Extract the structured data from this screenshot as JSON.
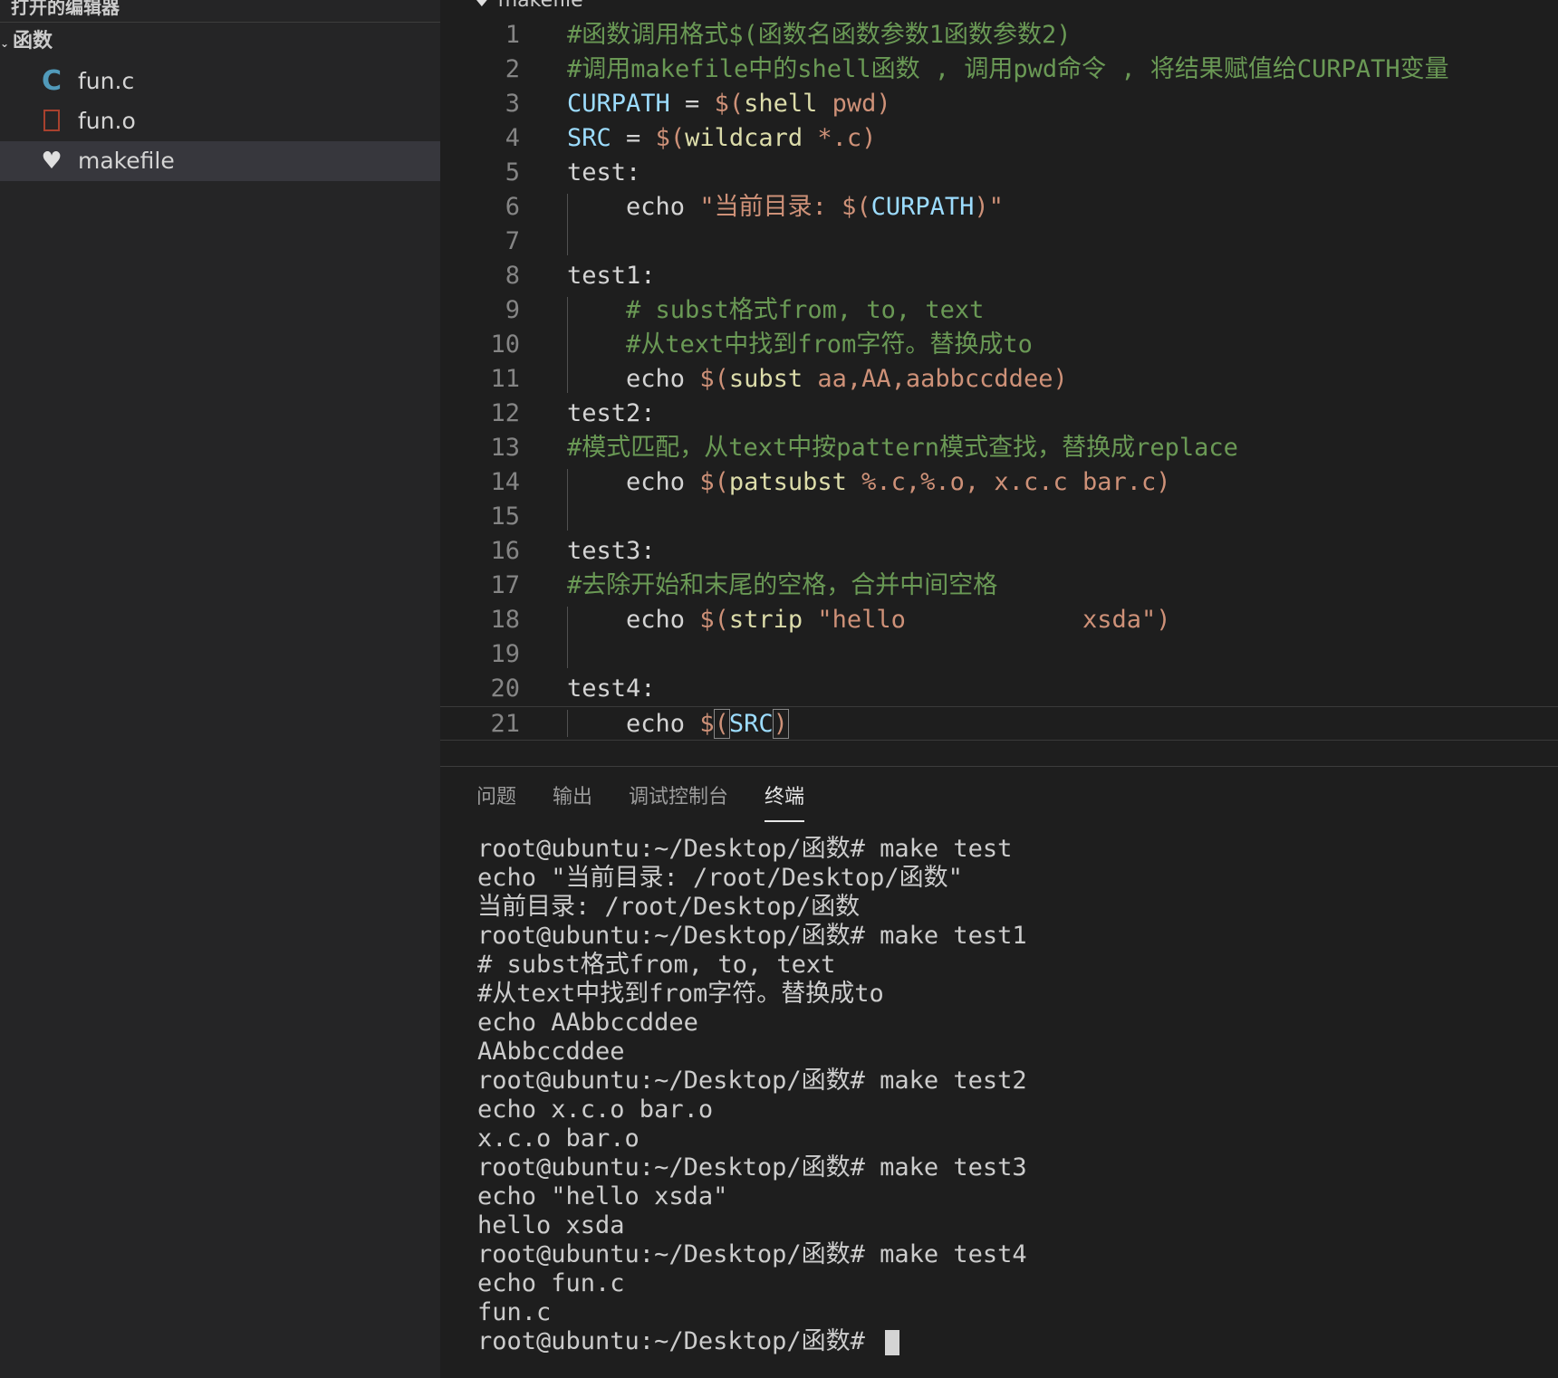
{
  "sidebar": {
    "header": "打开的编辑器",
    "folder": "函数",
    "files": [
      {
        "name": "fun.c",
        "icon": "c-file-icon"
      },
      {
        "name": "fun.o",
        "icon": "binary-file-icon"
      },
      {
        "name": "makefile",
        "icon": "makefile-icon"
      }
    ],
    "selected": "makefile"
  },
  "editor": {
    "tab_title": "makefile",
    "lines": [
      {
        "n": "1",
        "tokens": [
          {
            "t": "#函数调用格式$(函数名函数参数1函数参数2)",
            "c": "k-c"
          }
        ]
      },
      {
        "n": "2",
        "tokens": [
          {
            "t": "#调用makefile中的shell函数 , 调用pwd命令 , 将结果赋值给CURPATH变量",
            "c": "k-c"
          }
        ]
      },
      {
        "n": "3",
        "tokens": [
          {
            "t": "CURPATH",
            "c": "k-v"
          },
          {
            "t": " = ",
            "c": "k-t"
          },
          {
            "t": "$(",
            "c": "k-s"
          },
          {
            "t": "shell",
            "c": "k-f"
          },
          {
            "t": " pwd)",
            "c": "k-s"
          }
        ]
      },
      {
        "n": "4",
        "tokens": [
          {
            "t": "SRC",
            "c": "k-v"
          },
          {
            "t": " = ",
            "c": "k-t"
          },
          {
            "t": "$(",
            "c": "k-s"
          },
          {
            "t": "wildcard",
            "c": "k-f"
          },
          {
            "t": " *.c)",
            "c": "k-s"
          }
        ]
      },
      {
        "n": "5",
        "tokens": [
          {
            "t": "test:",
            "c": "k-t"
          }
        ]
      },
      {
        "n": "6",
        "tokens": [
          {
            "t": "    echo ",
            "c": "k-t"
          },
          {
            "t": "\"当前目录: ",
            "c": "k-s"
          },
          {
            "t": "$(",
            "c": "k-s"
          },
          {
            "t": "CURPATH",
            "c": "k-v"
          },
          {
            "t": ")\"",
            "c": "k-s"
          }
        ]
      },
      {
        "n": "7",
        "tokens": []
      },
      {
        "n": "8",
        "tokens": [
          {
            "t": "test1:",
            "c": "k-t"
          }
        ]
      },
      {
        "n": "9",
        "tokens": [
          {
            "t": "    # subst格式from, to, text",
            "c": "k-c"
          }
        ]
      },
      {
        "n": "10",
        "tokens": [
          {
            "t": "    #从text中找到from字符。替换成to",
            "c": "k-c"
          }
        ]
      },
      {
        "n": "11",
        "tokens": [
          {
            "t": "    echo ",
            "c": "k-t"
          },
          {
            "t": "$(",
            "c": "k-s"
          },
          {
            "t": "subst",
            "c": "k-f"
          },
          {
            "t": " aa,AA,aabbccddee)",
            "c": "k-s"
          }
        ]
      },
      {
        "n": "12",
        "tokens": [
          {
            "t": "test2:",
            "c": "k-t"
          }
        ]
      },
      {
        "n": "13",
        "tokens": [
          {
            "t": "#模式匹配，从text中按pattern模式查找，替换成replace",
            "c": "k-c"
          }
        ]
      },
      {
        "n": "14",
        "tokens": [
          {
            "t": "    echo ",
            "c": "k-t"
          },
          {
            "t": "$(",
            "c": "k-s"
          },
          {
            "t": "patsubst",
            "c": "k-f"
          },
          {
            "t": " %.c,%.o, x.c.c bar.c)",
            "c": "k-s"
          }
        ]
      },
      {
        "n": "15",
        "tokens": []
      },
      {
        "n": "16",
        "tokens": [
          {
            "t": "test3:",
            "c": "k-t"
          }
        ]
      },
      {
        "n": "17",
        "tokens": [
          {
            "t": "#去除开始和末尾的空格，合并中间空格",
            "c": "k-c"
          }
        ]
      },
      {
        "n": "18",
        "tokens": [
          {
            "t": "    echo ",
            "c": "k-t"
          },
          {
            "t": "$(",
            "c": "k-s"
          },
          {
            "t": "strip",
            "c": "k-f"
          },
          {
            "t": " \"hello            xsda\")",
            "c": "k-s"
          }
        ]
      },
      {
        "n": "19",
        "tokens": []
      },
      {
        "n": "20",
        "tokens": [
          {
            "t": "test4:",
            "c": "k-t"
          }
        ]
      },
      {
        "n": "21",
        "tokens": [
          {
            "t": "    echo ",
            "c": "k-t"
          },
          {
            "t": "$",
            "c": "k-s"
          },
          {
            "t": "(",
            "c": "k-s brk"
          },
          {
            "t": "SRC",
            "c": "k-v"
          },
          {
            "t": ")",
            "c": "k-s brk"
          }
        ]
      }
    ]
  },
  "panel": {
    "tabs": [
      "问题",
      "输出",
      "调试控制台",
      "终端"
    ],
    "active_tab": "终端",
    "terminal_lines": [
      "root@ubuntu:~/Desktop/函数# make test",
      "echo \"当前目录: /root/Desktop/函数\"",
      "当前目录: /root/Desktop/函数",
      "root@ubuntu:~/Desktop/函数# make test1",
      "# subst格式from, to, text",
      "#从text中找到from字符。替换成to",
      "echo AAbbccddee",
      "AAbbccddee",
      "root@ubuntu:~/Desktop/函数# make test2",
      "echo x.c.o bar.o",
      "x.c.o bar.o",
      "root@ubuntu:~/Desktop/函数# make test3",
      "echo \"hello xsda\"",
      "hello xsda",
      "root@ubuntu:~/Desktop/函数# make test4",
      "echo fun.c",
      "fun.c",
      "root@ubuntu:~/Desktop/函数# "
    ]
  }
}
